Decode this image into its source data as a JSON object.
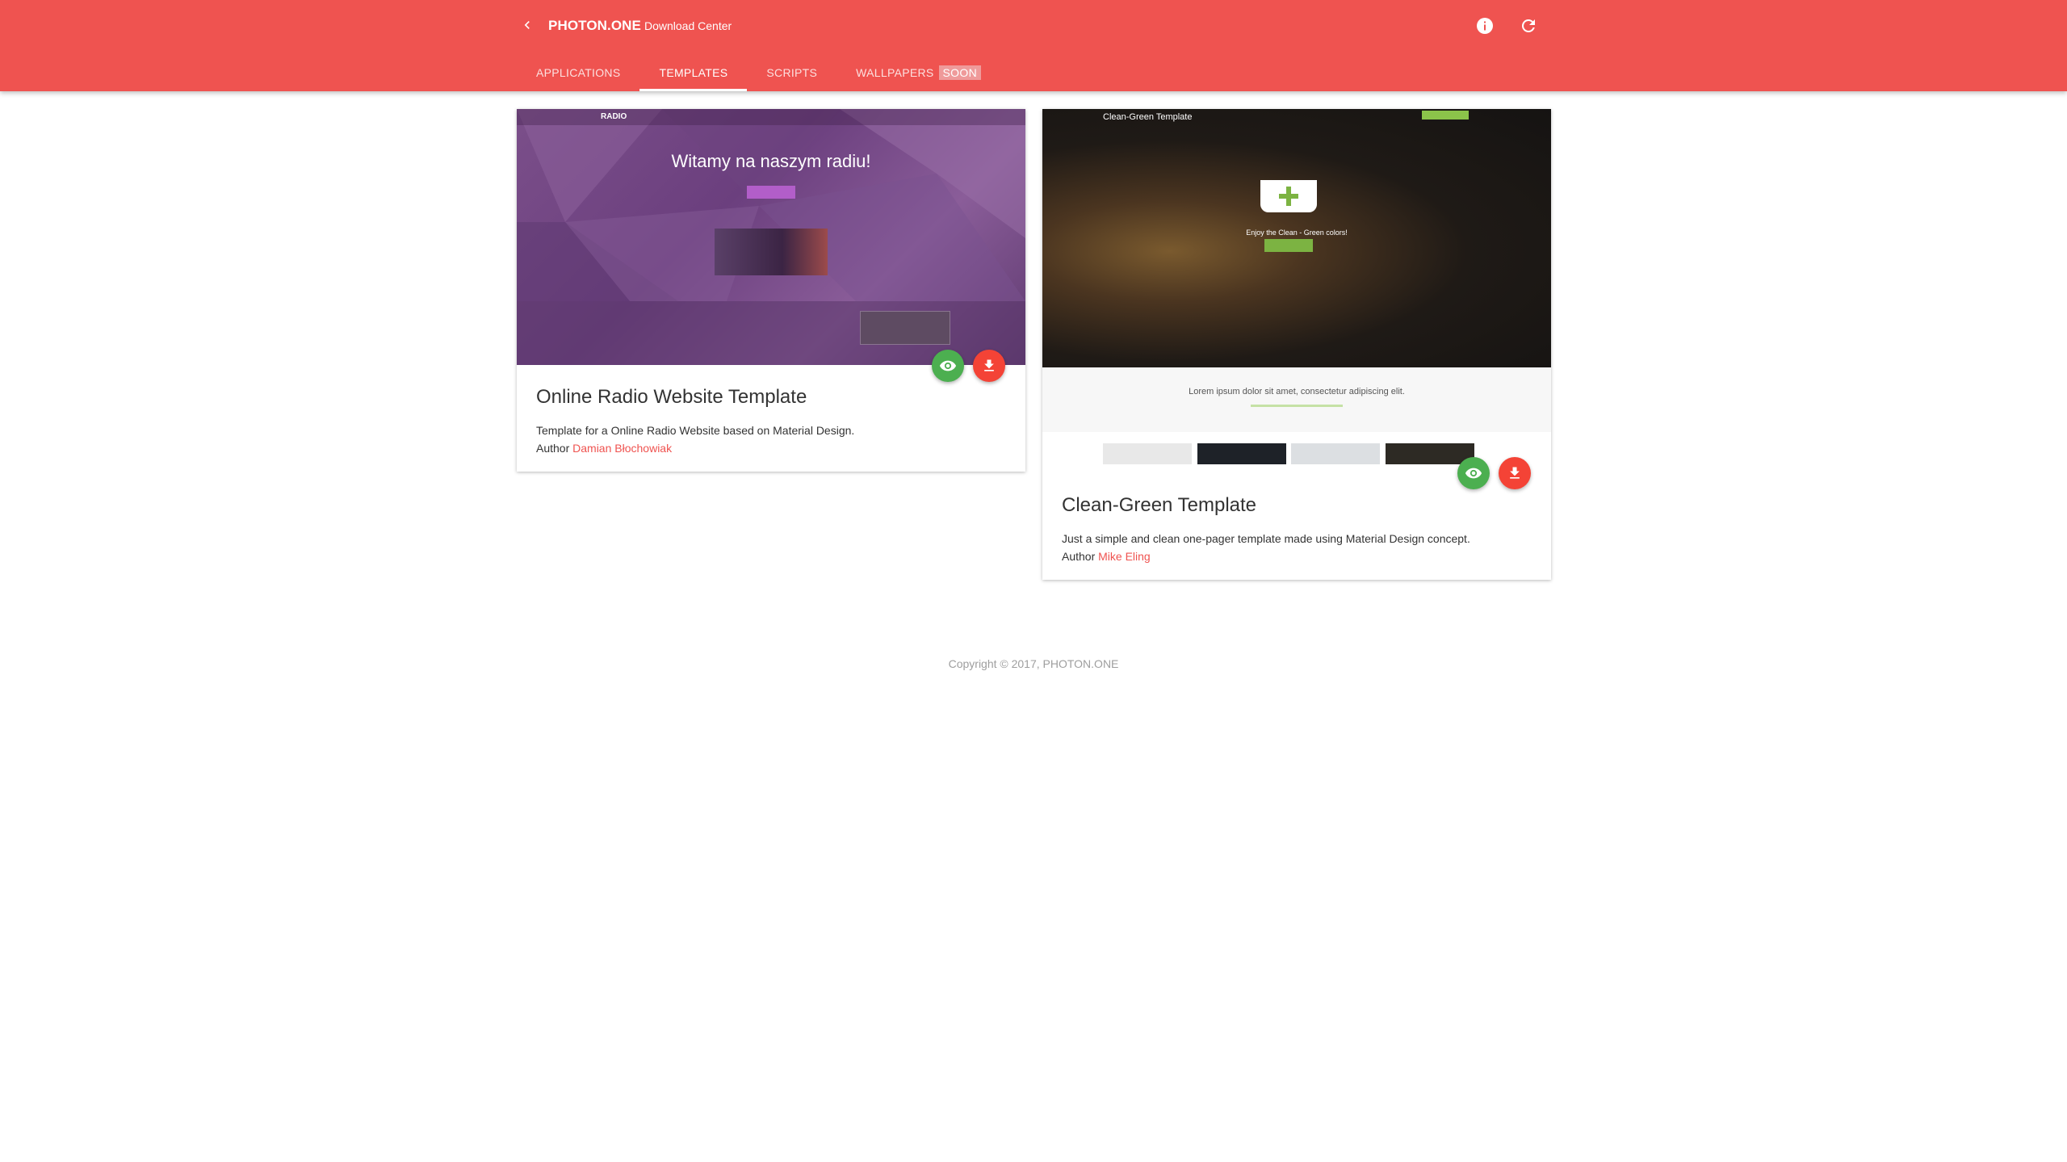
{
  "header": {
    "brand": "PHOTON.ONE",
    "subtitle": "Download Center",
    "back_icon": "chevron-left-icon",
    "info_icon": "info-icon",
    "refresh_icon": "refresh-icon"
  },
  "tabs": [
    {
      "label": "APPLICATIONS",
      "active": false
    },
    {
      "label": "TEMPLATES",
      "active": true
    },
    {
      "label": "SCRIPTS",
      "active": false
    },
    {
      "label": "WALLPAPERS",
      "active": false,
      "badge": "SOON"
    }
  ],
  "cards": [
    {
      "title": "Online Radio Website Template",
      "description": "Template for a Online Radio Website based on Material Design.",
      "author_label": "Author",
      "author_name": "Damian Błochowiak",
      "preview": {
        "logo": "RADIO",
        "heading": "Witamy na naszym radiu!"
      }
    },
    {
      "title": "Clean-Green Template",
      "description": "Just a simple and clean one-pager template made using Material Design concept.",
      "author_label": "Author",
      "author_name": "Mike Eling",
      "preview": {
        "logo": "Clean-Green Template",
        "tagline": "Enjoy the Clean - Green colors!",
        "lorem": "Lorem ipsum dolor sit amet, consectetur adipiscing elit."
      }
    }
  ],
  "footer": {
    "copyright": "Copyright © 2017, PHOTON.ONE"
  },
  "colors": {
    "primary": "#ef5350",
    "fab_view": "#4caf50",
    "fab_download": "#f44336",
    "link": "#ef5350"
  }
}
